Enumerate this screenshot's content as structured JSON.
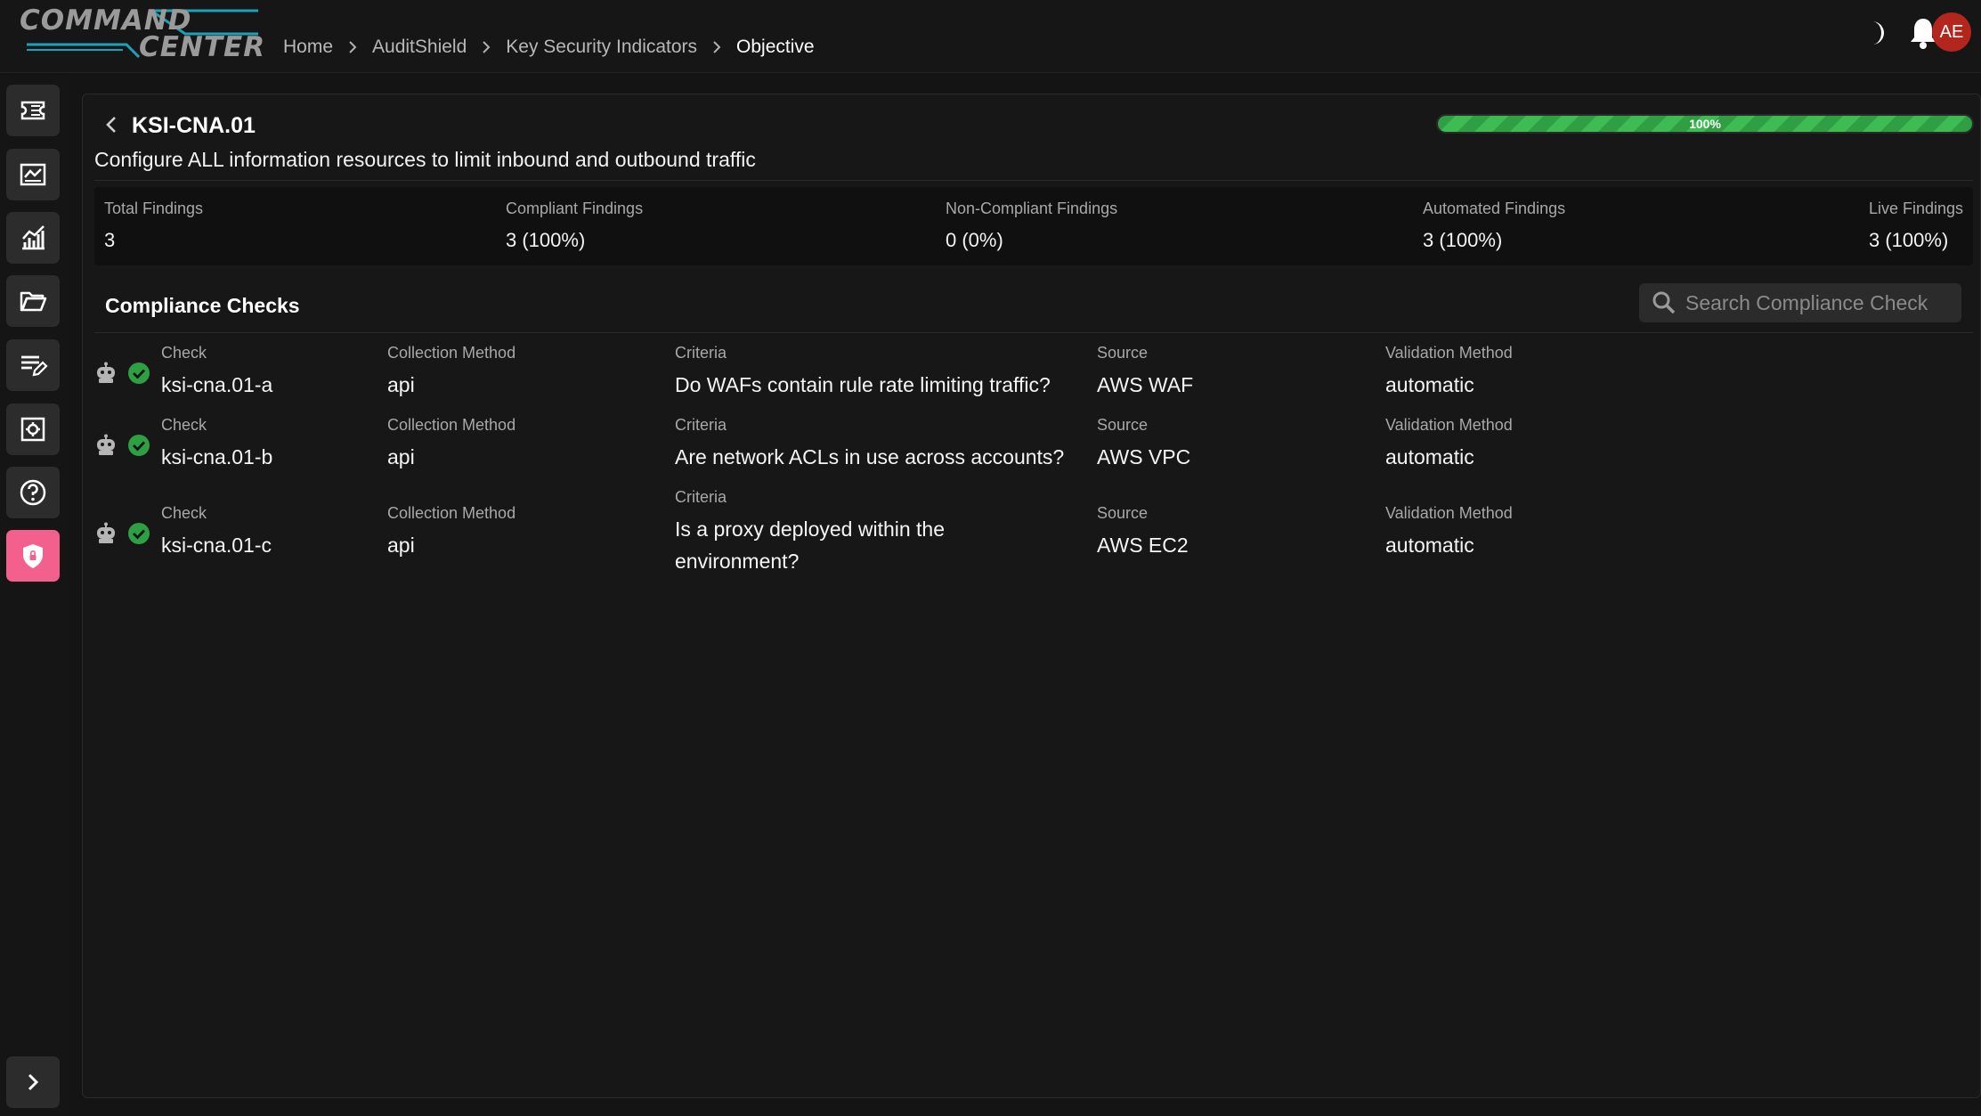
{
  "brand": {
    "line1": "COMMAND",
    "line2": "CENTER"
  },
  "breadcrumb": [
    "Home",
    "AuditShield",
    "Key Security Indicators",
    "Objective"
  ],
  "user": {
    "initials": "AE"
  },
  "colors": {
    "accent": "#f4608e",
    "success": "#3fbb54",
    "avatar": "#b3261e"
  },
  "sidebar": {
    "items": [
      {
        "icon": "ticket-icon"
      },
      {
        "icon": "dashboard-icon"
      },
      {
        "icon": "analytics-icon"
      },
      {
        "icon": "folder-icon"
      },
      {
        "icon": "edit-list-icon"
      },
      {
        "icon": "settings-box-icon"
      },
      {
        "icon": "help-icon"
      },
      {
        "icon": "shield-icon",
        "active": true
      }
    ],
    "expand_icon": "chevron-right-icon"
  },
  "objective": {
    "id": "KSI-CNA.01",
    "description": "Configure ALL information resources to limit inbound and outbound traffic",
    "progress": 100,
    "progress_label": "100%"
  },
  "stats": [
    {
      "label": "Total Findings",
      "value": "3"
    },
    {
      "label": "Compliant Findings",
      "value": "3 (100%)"
    },
    {
      "label": "Non-Compliant Findings",
      "value": "0 (0%)"
    },
    {
      "label": "Automated Findings",
      "value": "3 (100%)"
    },
    {
      "label": "Live Findings",
      "value": "3 (100%)"
    }
  ],
  "compliance": {
    "title": "Compliance Checks",
    "search_placeholder": "Search Compliance Check",
    "columns": [
      "Check",
      "Collection Method",
      "Criteria",
      "Source",
      "Validation Method"
    ],
    "rows": [
      {
        "check": "ksi-cna.01-a",
        "collection": "api",
        "criteria": "Do WAFs contain rule rate limiting traffic?",
        "source": "AWS WAF",
        "validation": "automatic"
      },
      {
        "check": "ksi-cna.01-b",
        "collection": "api",
        "criteria": "Are network ACLs in use across accounts?",
        "source": "AWS VPC",
        "validation": "automatic"
      },
      {
        "check": "ksi-cna.01-c",
        "collection": "api",
        "criteria": "Is a proxy deployed within the environment?",
        "source": "AWS EC2",
        "validation": "automatic"
      }
    ]
  }
}
